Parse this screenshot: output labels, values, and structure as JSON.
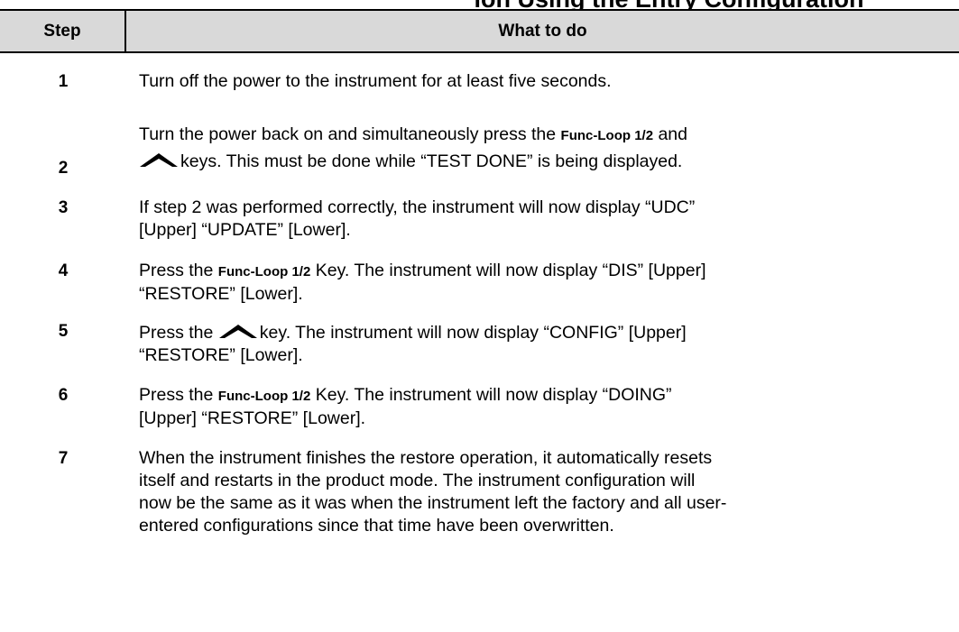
{
  "page": {
    "cut_title": "ion Using the Entry Configuration"
  },
  "table": {
    "headers": {
      "step": "Step",
      "what": "What to do"
    },
    "key_name": "Func-Loop 1/2",
    "rows": [
      {
        "step": "1",
        "text": "Turn off the power to the instrument for at least five seconds."
      },
      {
        "step": "2",
        "line1_before": "Turn the power back on and simultaneously press the ",
        "line1_key": "Func-Loop 1/2",
        "line1_after": " and",
        "line2_after": "keys. This must be done while “TEST DONE” is being displayed.",
        "up_key_icon": "up-arrow-key-icon"
      },
      {
        "step": "3",
        "line1": "If step 2 was performed correctly, the instrument will now display “UDC”",
        "line2": "[Upper] “UPDATE” [Lower]."
      },
      {
        "step": "4",
        "before": "Press the ",
        "key": "Func-Loop 1/2",
        "line1_after": " Key. The instrument will now display “DIS” [Upper]",
        "line2": "“RESTORE” [Lower].",
        "up_key_icon": ""
      },
      {
        "step": "5",
        "before": "Press the ",
        "line1_after": "key. The instrument will now display “CONFIG” [Upper]",
        "line2": "“RESTORE” [Lower].",
        "up_key_icon": "up-arrow-key-icon"
      },
      {
        "step": "6",
        "before": "Press the ",
        "key": "Func-Loop 1/2",
        "line1_after": " Key. The instrument will now display “DOING”",
        "line2": "[Upper] “RESTORE” [Lower]."
      },
      {
        "step": "7",
        "lines": [
          "When the instrument finishes the restore operation, it automatically resets",
          "itself and restarts in the product mode. The instrument configuration will",
          "now be the same as it was when the instrument left the factory and all user-",
          "entered configurations since that time have been overwritten."
        ]
      }
    ]
  }
}
